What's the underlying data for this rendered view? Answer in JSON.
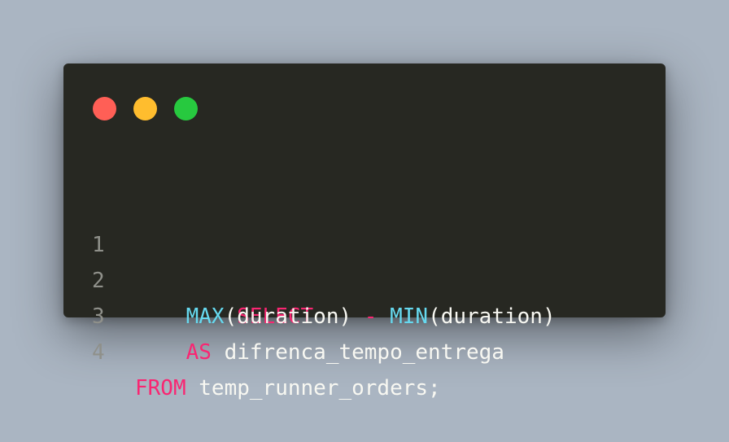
{
  "colors": {
    "background": "#aab5c2",
    "window": "#272822",
    "keyword": "#f92672",
    "function": "#66d9ef",
    "text": "#f8f8f2",
    "line_number": "#8f908a",
    "dot_red": "#ff5f56",
    "dot_yellow": "#ffbd2e",
    "dot_green": "#27c93f"
  },
  "window_controls": [
    "close-dot",
    "minimize-dot",
    "maximize-dot"
  ],
  "code": {
    "lines": [
      {
        "number": "1",
        "tokens": [
          {
            "text": "SELECT",
            "kind": "keyword"
          }
        ]
      },
      {
        "number": "2",
        "tokens": [
          {
            "text": "    ",
            "kind": "plain"
          },
          {
            "text": "MAX",
            "kind": "function"
          },
          {
            "text": "(duration) ",
            "kind": "plain"
          },
          {
            "text": "-",
            "kind": "keyword"
          },
          {
            "text": " ",
            "kind": "plain"
          },
          {
            "text": "MIN",
            "kind": "function"
          },
          {
            "text": "(duration)",
            "kind": "plain"
          }
        ]
      },
      {
        "number": "3",
        "tokens": [
          {
            "text": "    ",
            "kind": "plain"
          },
          {
            "text": "AS",
            "kind": "keyword"
          },
          {
            "text": " difrenca_tempo_entrega",
            "kind": "plain"
          }
        ]
      },
      {
        "number": "4",
        "tokens": [
          {
            "text": "FROM",
            "kind": "keyword"
          },
          {
            "text": " temp_runner_orders;",
            "kind": "plain"
          }
        ]
      }
    ]
  }
}
